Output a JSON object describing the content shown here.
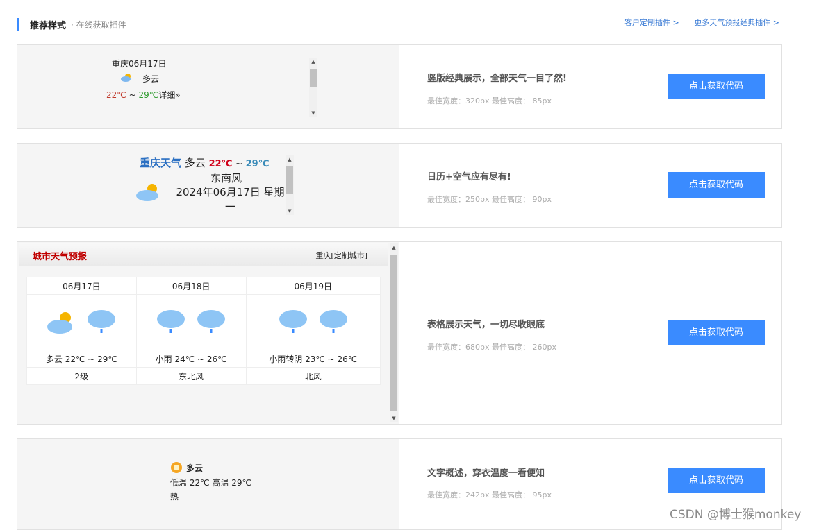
{
  "header": {
    "title": "推荐样式",
    "subtitle": "· 在线获取插件",
    "link_custom": "客户定制插件 >",
    "link_more": "更多天气预报经典插件 >"
  },
  "button_label": "点击获取代码",
  "cards": [
    {
      "title": "竖版经典展示，全部天气一目了然!",
      "size": "最佳宽度：320px 最佳高度： 85px",
      "widget": {
        "city_date": "重庆06月17日",
        "weather": "多云",
        "low": "22℃",
        "tilde": " ~ ",
        "high": "29℃",
        "detail": "详细»"
      }
    },
    {
      "title": "日历+空气应有尽有!",
      "size": "最佳宽度：250px 最佳高度： 90px",
      "widget": {
        "city": "重庆天气",
        "weather": "多云",
        "low": "22℃",
        "tilde": " ~ ",
        "high": "29℃",
        "wind": "东南风",
        "date": "2024年06月17日 星期一"
      }
    },
    {
      "title": "表格展示天气，一切尽收眼底",
      "size": "最佳宽度：680px 最佳高度： 260px",
      "widget": {
        "heading": "城市天气预报",
        "city": "重庆[定制城市]",
        "days": [
          {
            "date": "06月17日",
            "desc": "多云 22℃ ~ 29℃",
            "wind": "2级",
            "icon1": "partly-cloudy-icon",
            "icon2": "rain-cloud-icon"
          },
          {
            "date": "06月18日",
            "desc": "小雨 24℃ ~ 26℃",
            "wind": "东北风",
            "icon1": "rain-cloud-icon",
            "icon2": "rain-cloud-icon"
          },
          {
            "date": "06月19日",
            "desc": "小雨转阴 23℃ ~ 26℃",
            "wind": "北风",
            "icon1": "rain-cloud-icon",
            "icon2": "rain-cloud-icon"
          }
        ]
      }
    },
    {
      "title": "文字概述，穿衣温度一看便知",
      "size": "最佳宽度：242px 最佳高度： 95px",
      "widget": {
        "weather": "多云",
        "temps": "低温 22℃ 高温 29℃",
        "feel": "热"
      }
    }
  ],
  "watermark": "CSDN @博士猴monkey",
  "colors": {
    "accent": "#3a8bff",
    "low_temp": "#c0392b",
    "high_temp": "#2e9b2e",
    "city_blue": "#2a6fc2",
    "red_heading": "#c00000"
  }
}
